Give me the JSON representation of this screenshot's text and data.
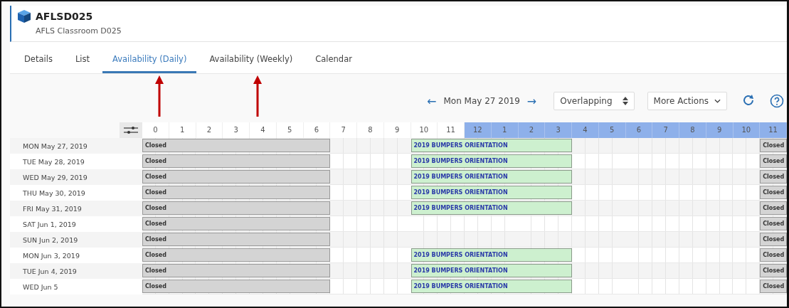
{
  "header": {
    "title": "AFLSD025",
    "subtitle": "AFLS Classroom D025"
  },
  "tabs": [
    {
      "label": "Details",
      "selected": false
    },
    {
      "label": "List",
      "selected": false
    },
    {
      "label": "Availability (Daily)",
      "selected": true
    },
    {
      "label": "Availability (Weekly)",
      "selected": false
    },
    {
      "label": "Calendar",
      "selected": false
    }
  ],
  "toolbar": {
    "prev": "←",
    "date": "Mon May 27 2019",
    "next": "→",
    "mode": "Overlapping",
    "more_actions": "More Actions"
  },
  "hours": [
    {
      "label": "0",
      "pm": false
    },
    {
      "label": "1",
      "pm": false
    },
    {
      "label": "2",
      "pm": false
    },
    {
      "label": "3",
      "pm": false
    },
    {
      "label": "4",
      "pm": false
    },
    {
      "label": "5",
      "pm": false
    },
    {
      "label": "6",
      "pm": false
    },
    {
      "label": "7",
      "pm": false
    },
    {
      "label": "8",
      "pm": false
    },
    {
      "label": "9",
      "pm": false
    },
    {
      "label": "10",
      "pm": false
    },
    {
      "label": "11",
      "pm": false
    },
    {
      "label": "12",
      "pm": true
    },
    {
      "label": "1",
      "pm": true
    },
    {
      "label": "2",
      "pm": true
    },
    {
      "label": "3",
      "pm": true
    },
    {
      "label": "4",
      "pm": true
    },
    {
      "label": "5",
      "pm": true
    },
    {
      "label": "6",
      "pm": true
    },
    {
      "label": "7",
      "pm": true
    },
    {
      "label": "8",
      "pm": true
    },
    {
      "label": "9",
      "pm": true
    },
    {
      "label": "10",
      "pm": true
    },
    {
      "label": "11",
      "pm": true
    }
  ],
  "rows": [
    {
      "date": "MON May 27, 2019",
      "events": [
        {
          "kind": "closed_early",
          "label": "Closed"
        },
        {
          "kind": "booking",
          "label": "2019 BUMPERS ORIENTATION"
        },
        {
          "kind": "closed_late",
          "label": "Closed"
        }
      ]
    },
    {
      "date": "TUE May 28, 2019",
      "events": [
        {
          "kind": "closed_early",
          "label": "Closed"
        },
        {
          "kind": "booking",
          "label": "2019 BUMPERS ORIENTATION"
        },
        {
          "kind": "closed_late",
          "label": "Closed"
        }
      ]
    },
    {
      "date": "WED May 29, 2019",
      "events": [
        {
          "kind": "closed_early",
          "label": "Closed"
        },
        {
          "kind": "booking",
          "label": "2019 BUMPERS ORIENTATION"
        },
        {
          "kind": "closed_late",
          "label": "Closed"
        }
      ]
    },
    {
      "date": "THU May 30, 2019",
      "events": [
        {
          "kind": "closed_early",
          "label": "Closed"
        },
        {
          "kind": "booking",
          "label": "2019 BUMPERS ORIENTATION"
        },
        {
          "kind": "closed_late",
          "label": "Closed"
        }
      ]
    },
    {
      "date": "FRI May 31, 2019",
      "events": [
        {
          "kind": "closed_early",
          "label": "Closed"
        },
        {
          "kind": "booking",
          "label": "2019 BUMPERS ORIENTATION"
        },
        {
          "kind": "closed_late",
          "label": "Closed"
        }
      ]
    },
    {
      "date": "SAT Jun 1, 2019",
      "events": [
        {
          "kind": "closed_early",
          "label": "Closed"
        },
        {
          "kind": "closed_late",
          "label": "Closed"
        }
      ]
    },
    {
      "date": "SUN Jun 2, 2019",
      "events": [
        {
          "kind": "closed_early",
          "label": "Closed"
        },
        {
          "kind": "closed_late",
          "label": "Closed"
        }
      ]
    },
    {
      "date": "MON Jun 3, 2019",
      "events": [
        {
          "kind": "closed_early",
          "label": "Closed"
        },
        {
          "kind": "booking",
          "label": "2019 BUMPERS ORIENTATION"
        },
        {
          "kind": "closed_late",
          "label": "Closed"
        }
      ]
    },
    {
      "date": "TUE Jun 4, 2019",
      "events": [
        {
          "kind": "closed_early",
          "label": "Closed"
        },
        {
          "kind": "booking",
          "label": "2019 BUMPERS ORIENTATION"
        },
        {
          "kind": "closed_late",
          "label": "Closed"
        }
      ]
    },
    {
      "date": "WED Jun 5",
      "events": [
        {
          "kind": "closed_early",
          "label": "Closed"
        },
        {
          "kind": "booking",
          "label": "2019 BUMPERS ORIENTATION"
        },
        {
          "kind": "closed_late",
          "label": "Closed"
        }
      ]
    }
  ]
}
